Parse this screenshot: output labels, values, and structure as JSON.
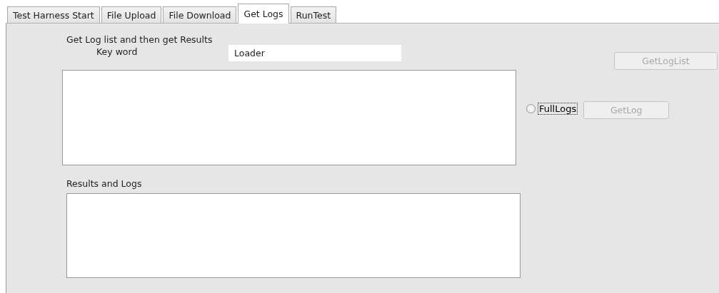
{
  "tabs": [
    {
      "label": "Test Harness Start",
      "selected": false
    },
    {
      "label": "File Upload",
      "selected": false
    },
    {
      "label": "File Download",
      "selected": false
    },
    {
      "label": "Get Logs",
      "selected": true
    },
    {
      "label": "RunTest",
      "selected": false
    }
  ],
  "heading": "Get Log list and then get Results",
  "keyword": {
    "label": "Key word",
    "value": "Loader"
  },
  "get_log_list_button": {
    "label": "GetLogList",
    "disabled": true
  },
  "full_logs_radio": {
    "label": "FullLogs",
    "selected": false,
    "focused": true
  },
  "get_log_button": {
    "label": "GetLog",
    "disabled": true
  },
  "results_label": "Results and Logs"
}
